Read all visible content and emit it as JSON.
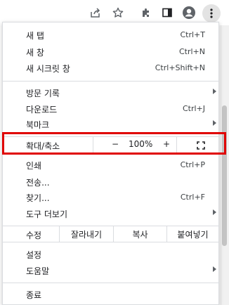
{
  "toolbar": {
    "icons": [
      "share-icon",
      "star-icon",
      "extensions-icon",
      "side-panel-icon",
      "profile-icon",
      "more-icon"
    ]
  },
  "menu": {
    "new_tab": {
      "label": "새 탭",
      "shortcut": "Ctrl+T"
    },
    "new_window": {
      "label": "새 창",
      "shortcut": "Ctrl+N"
    },
    "new_incognito": {
      "label": "새 시크릿 창",
      "shortcut": "Ctrl+Shift+N"
    },
    "history": {
      "label": "방문 기록"
    },
    "downloads": {
      "label": "다운로드",
      "shortcut": "Ctrl+J"
    },
    "bookmarks": {
      "label": "북마크"
    },
    "zoom": {
      "label": "확대/축소",
      "minus": "−",
      "level": "100%",
      "plus": "+"
    },
    "print": {
      "label": "인쇄",
      "shortcut": "Ctrl+P"
    },
    "cast": {
      "label": "전송..."
    },
    "find": {
      "label": "찾기...",
      "shortcut": "Ctrl+F"
    },
    "more_tools": {
      "label": "도구 더보기"
    },
    "edit": {
      "label": "수정",
      "cut": "잘라내기",
      "copy": "복사",
      "paste": "붙여넣기"
    },
    "settings": {
      "label": "설정"
    },
    "help": {
      "label": "도움말"
    },
    "exit": {
      "label": "종료"
    }
  },
  "colors": {
    "highlight": "#e00000",
    "separator": "#dadce0",
    "text": "#202124"
  }
}
